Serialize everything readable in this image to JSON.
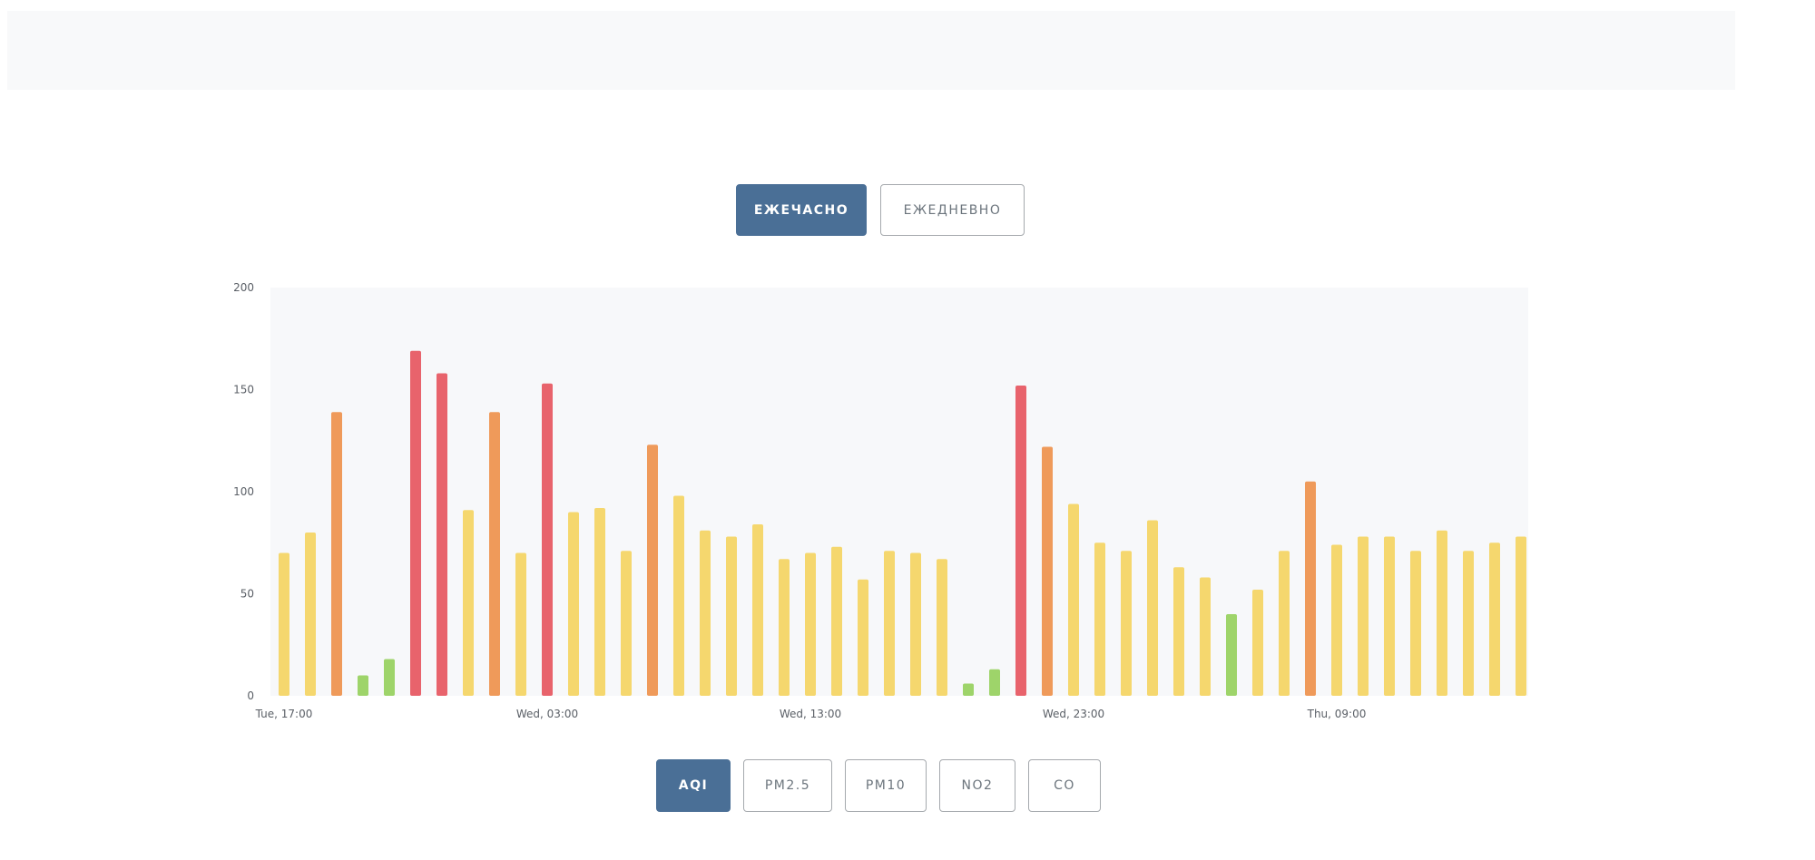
{
  "period_toggle": {
    "hourly_label": "ЕЖЕЧАСНО",
    "daily_label": "ЕЖЕДНЕВНО",
    "active": "hourly"
  },
  "pollutants": {
    "items": [
      "AQI",
      "PM2.5",
      "PM10",
      "NO2",
      "CO"
    ],
    "active": "AQI"
  },
  "colors": {
    "accent": "#4a6f96",
    "good": "#9ed46a",
    "moderate": "#f5d76e",
    "unhealthy_sensitive": "#ef9a5a",
    "unhealthy": "#e8636c"
  },
  "chart_data": {
    "type": "bar",
    "ylim": [
      0,
      200
    ],
    "yticks": [
      0,
      50,
      100,
      150,
      200
    ],
    "xtick_labels": [
      {
        "index": 0,
        "label": "Tue, 17:00"
      },
      {
        "index": 10,
        "label": "Wed, 03:00"
      },
      {
        "index": 20,
        "label": "Wed, 13:00"
      },
      {
        "index": 30,
        "label": "Wed, 23:00"
      },
      {
        "index": 40,
        "label": "Thu, 09:00"
      }
    ],
    "categories": [
      "Tue, 17:00",
      "Tue, 18:00",
      "Tue, 19:00",
      "Tue, 20:00",
      "Tue, 21:00",
      "Tue, 22:00",
      "Tue, 23:00",
      "Wed, 00:00",
      "Wed, 01:00",
      "Wed, 02:00",
      "Wed, 03:00",
      "Wed, 04:00",
      "Wed, 05:00",
      "Wed, 06:00",
      "Wed, 07:00",
      "Wed, 08:00",
      "Wed, 09:00",
      "Wed, 10:00",
      "Wed, 11:00",
      "Wed, 12:00",
      "Wed, 13:00",
      "Wed, 14:00",
      "Wed, 15:00",
      "Wed, 16:00",
      "Wed, 17:00",
      "Wed, 18:00",
      "Wed, 19:00",
      "Wed, 20:00",
      "Wed, 21:00",
      "Wed, 22:00",
      "Wed, 23:00",
      "Thu, 00:00",
      "Thu, 01:00",
      "Thu, 02:00",
      "Thu, 03:00",
      "Thu, 04:00",
      "Thu, 05:00",
      "Thu, 06:00",
      "Thu, 07:00",
      "Thu, 08:00",
      "Thu, 09:00",
      "Thu, 10:00",
      "Thu, 11:00",
      "Thu, 12:00",
      "Thu, 13:00",
      "Thu, 14:00",
      "Thu, 15:00",
      "Thu, 16:00"
    ],
    "values": [
      70,
      80,
      139,
      10,
      18,
      169,
      158,
      91,
      139,
      70,
      153,
      90,
      92,
      71,
      123,
      98,
      81,
      78,
      84,
      67,
      70,
      73,
      57,
      71,
      70,
      67,
      6,
      13,
      152,
      122,
      94,
      75,
      71,
      86,
      63,
      58,
      40,
      52,
      71,
      105,
      74,
      78,
      78,
      71,
      81,
      71,
      75,
      78
    ],
    "grid": false
  }
}
